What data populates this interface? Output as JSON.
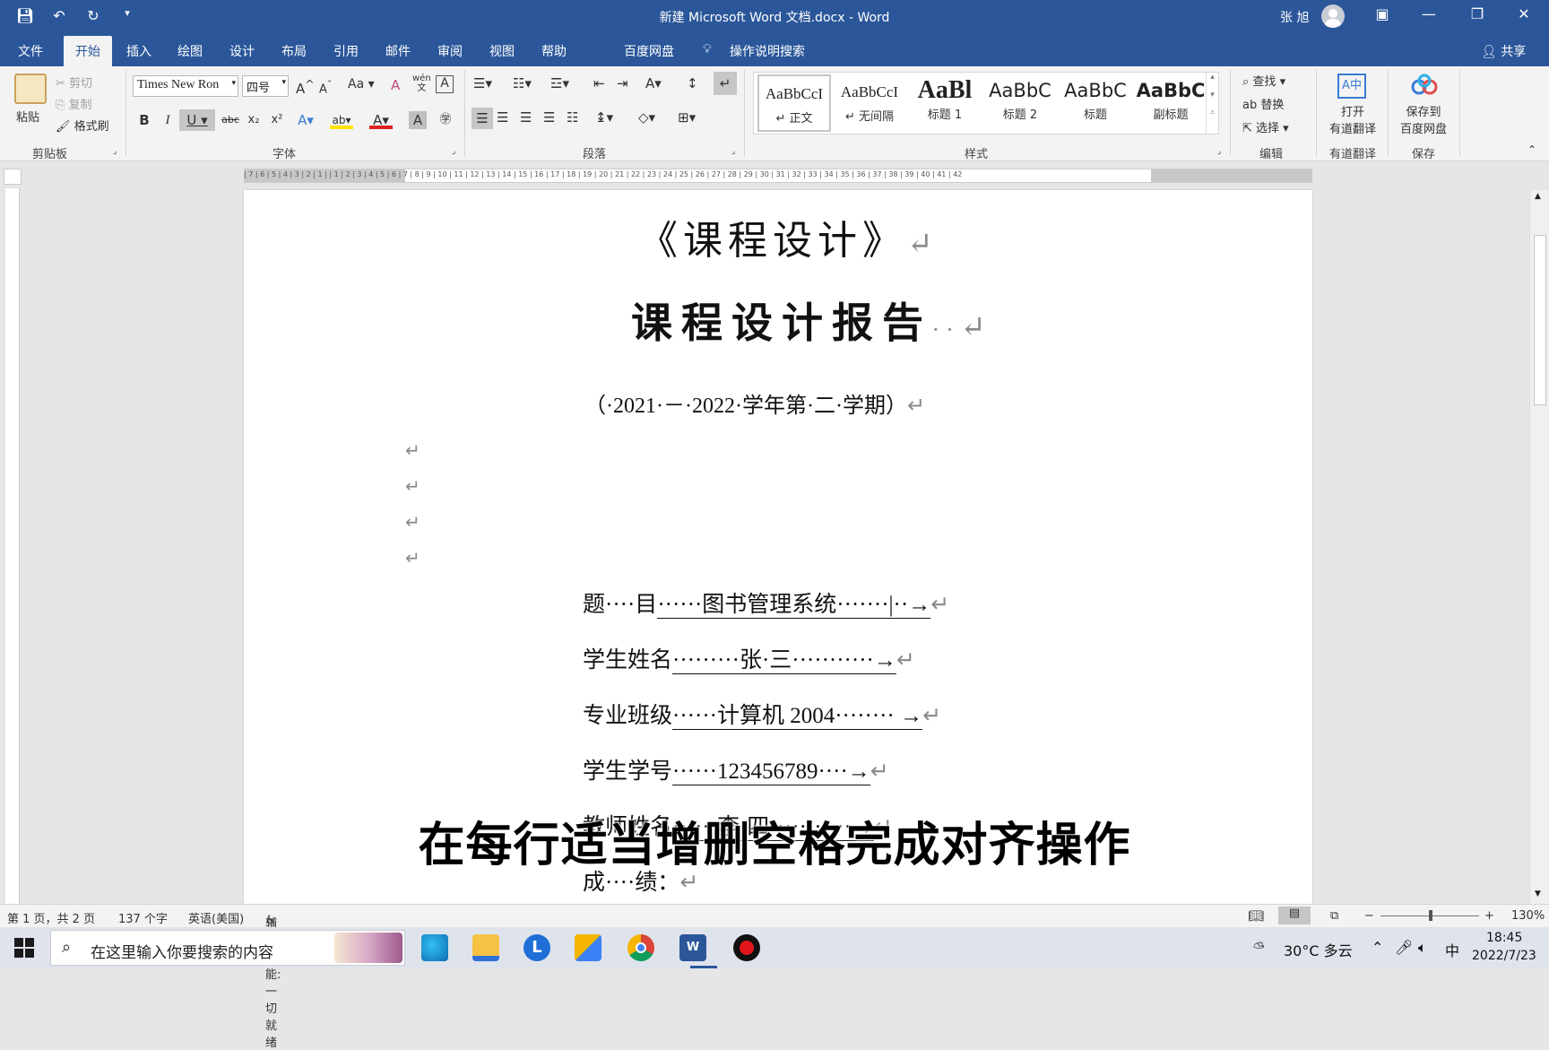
{
  "window": {
    "title": "新建 Microsoft Word 文档.docx  -  Word",
    "user_name": "张 旭",
    "qat_more": "▾"
  },
  "tabs": [
    "文件",
    "开始",
    "插入",
    "绘图",
    "设计",
    "布局",
    "引用",
    "邮件",
    "审阅",
    "视图",
    "帮助",
    "百度网盘",
    "操作说明搜索"
  ],
  "share_label": "共享",
  "ribbon": {
    "clipboard": {
      "paste": "粘贴",
      "cut": "剪切",
      "copy": "复制",
      "format_painter": "格式刷",
      "group": "剪贴板"
    },
    "font": {
      "name": "Times New Ron",
      "size": "四号",
      "change_case": "Aa",
      "group": "字体",
      "wen": "wén"
    },
    "paragraph": {
      "group": "段落"
    },
    "styles": {
      "group": "样式",
      "items": [
        {
          "preview": "AaBbCcI",
          "name": "↵ 正文"
        },
        {
          "preview": "AaBbCcI",
          "name": "↵ 无间隔"
        },
        {
          "preview": "AaBl",
          "name": "标题 1"
        },
        {
          "preview": "AaBbC",
          "name": "标题 2"
        },
        {
          "preview": "AaBbC",
          "name": "标题"
        },
        {
          "preview": "AaBbC",
          "name": "副标题"
        }
      ]
    },
    "editing": {
      "find": "查找",
      "replace": "替换",
      "select": "选择",
      "group": "编辑"
    },
    "youdao": {
      "open_line1": "打开",
      "open_line2": "有道翻译",
      "group": "有道翻译"
    },
    "baidu": {
      "save_line1": "保存到",
      "save_line2": "百度网盘",
      "group": "保存"
    }
  },
  "ruler": {
    "text": "| 7 | 6 | 5 | 4 | 3 | 2 | 1 |   | 1 | 2 | 3 | 4 | 5 | 6 | 7 | 8 | 9 | 10 | 11 | 12 | 13 | 14 | 15 | 16 | 17 | 18 | 19 | 20 | 21 | 22 | 23 | 24 | 25 | 26 | 27 | 28 | 29 | 30 | 31 | 32 | 33 | 34 | 35 | 36 | 37 | 38 | 39 | 40 | 41 | 42"
  },
  "document": {
    "title1": "《课程设计》",
    "title2": "课程设计报告",
    "title2_dots": "··",
    "semester": "（·2021·－·2022·学年第·二·学期）",
    "return_mark": "↵",
    "fields": [
      {
        "label": "题····目",
        "value": "······图书管理系统·······|··→"
      },
      {
        "label": "学生姓名",
        "value": "·········张·三···········→"
      },
      {
        "label": "专业班级",
        "value": "······计算机 2004········ →"
      },
      {
        "label": "学生学号",
        "value": "······123456789····→"
      },
      {
        "label": "教师姓名",
        "value": "······李·四···········→"
      },
      {
        "label": "成····绩：",
        "value": ""
      }
    ]
  },
  "overlay_caption": "在每行适当增删空格完成对齐操作",
  "status": {
    "page": "第 1 页，共 2 页",
    "words": "137 个字",
    "language": "英语(美国)",
    "accessibility": "辅助功能: 一切就绪",
    "zoom": "130%",
    "zoom_minus": "−",
    "zoom_plus": "+"
  },
  "taskbar": {
    "search_placeholder": "在这里输入你要搜索的内容",
    "weather": "30°C  多云",
    "ime": "中",
    "time": "18:45",
    "date": "2022/7/23"
  },
  "colors": {
    "word_blue": "#2b579a",
    "chrome_red": "#db4437",
    "record_red": "#e0161c"
  }
}
